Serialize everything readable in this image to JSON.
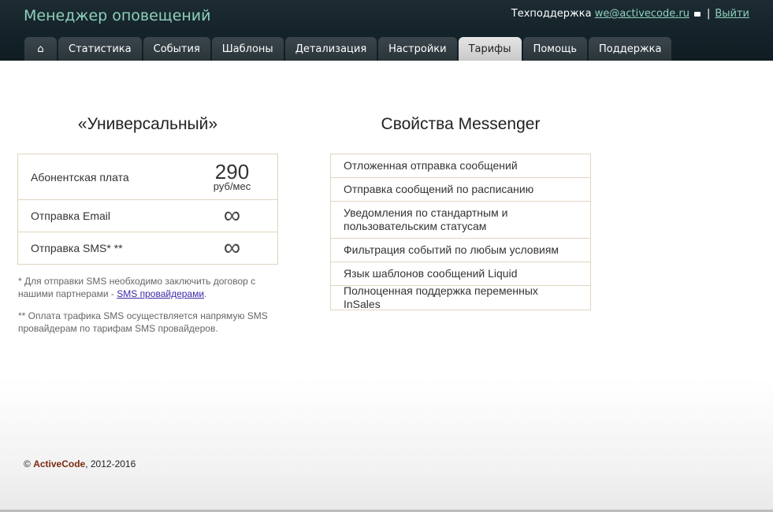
{
  "header": {
    "app_title": "Менеджер оповещений",
    "support_label": "Техподдержка",
    "support_email": "we@activecode.ru",
    "separator": "|",
    "logout_label": "Выйти"
  },
  "tabs": [
    {
      "label": "",
      "icon": "home-icon"
    },
    {
      "label": "Статистика"
    },
    {
      "label": "События"
    },
    {
      "label": "Шаблоны"
    },
    {
      "label": "Детализация"
    },
    {
      "label": "Настройки"
    },
    {
      "label": "Тарифы",
      "active": true
    },
    {
      "label": "Помощь"
    },
    {
      "label": "Поддержка"
    }
  ],
  "plan": {
    "title": "«Универсальный»",
    "rows": [
      {
        "label": "Абонентская плата",
        "value": "290",
        "unit": "руб/мес"
      },
      {
        "label": "Отправка Email",
        "value": "∞"
      },
      {
        "label": "Отправка SMS* **",
        "value": "∞"
      }
    ],
    "note1_text": "* Для отправки SMS необходимо заключить договор с нашими партнерами - ",
    "note1_link": "SMS провайдерами",
    "note1_end": ".",
    "note2": "** Оплата трафика SMS осуществляется напрямую SMS провайдерам по тарифам SMS провайдеров."
  },
  "features": {
    "title": "Свойства Messenger",
    "items": [
      "Отложенная отправка сообщений",
      "Отправка сообщений по расписанию",
      "Уведомления по стандартным и пользовательским статусам",
      "Фильтрация событий по любым условиям",
      "Язык шаблонов сообщений Liquid",
      "Полноценная поддержка переменных InSales"
    ]
  },
  "footer": {
    "copyright": "©",
    "brand": "ActiveCode",
    "years": ", 2012-2016"
  },
  "colors": {
    "header_bg": "#14232a",
    "title_accent": "#8fd0bc",
    "border": "#e0d5bf",
    "brand": "#7a2a10"
  }
}
